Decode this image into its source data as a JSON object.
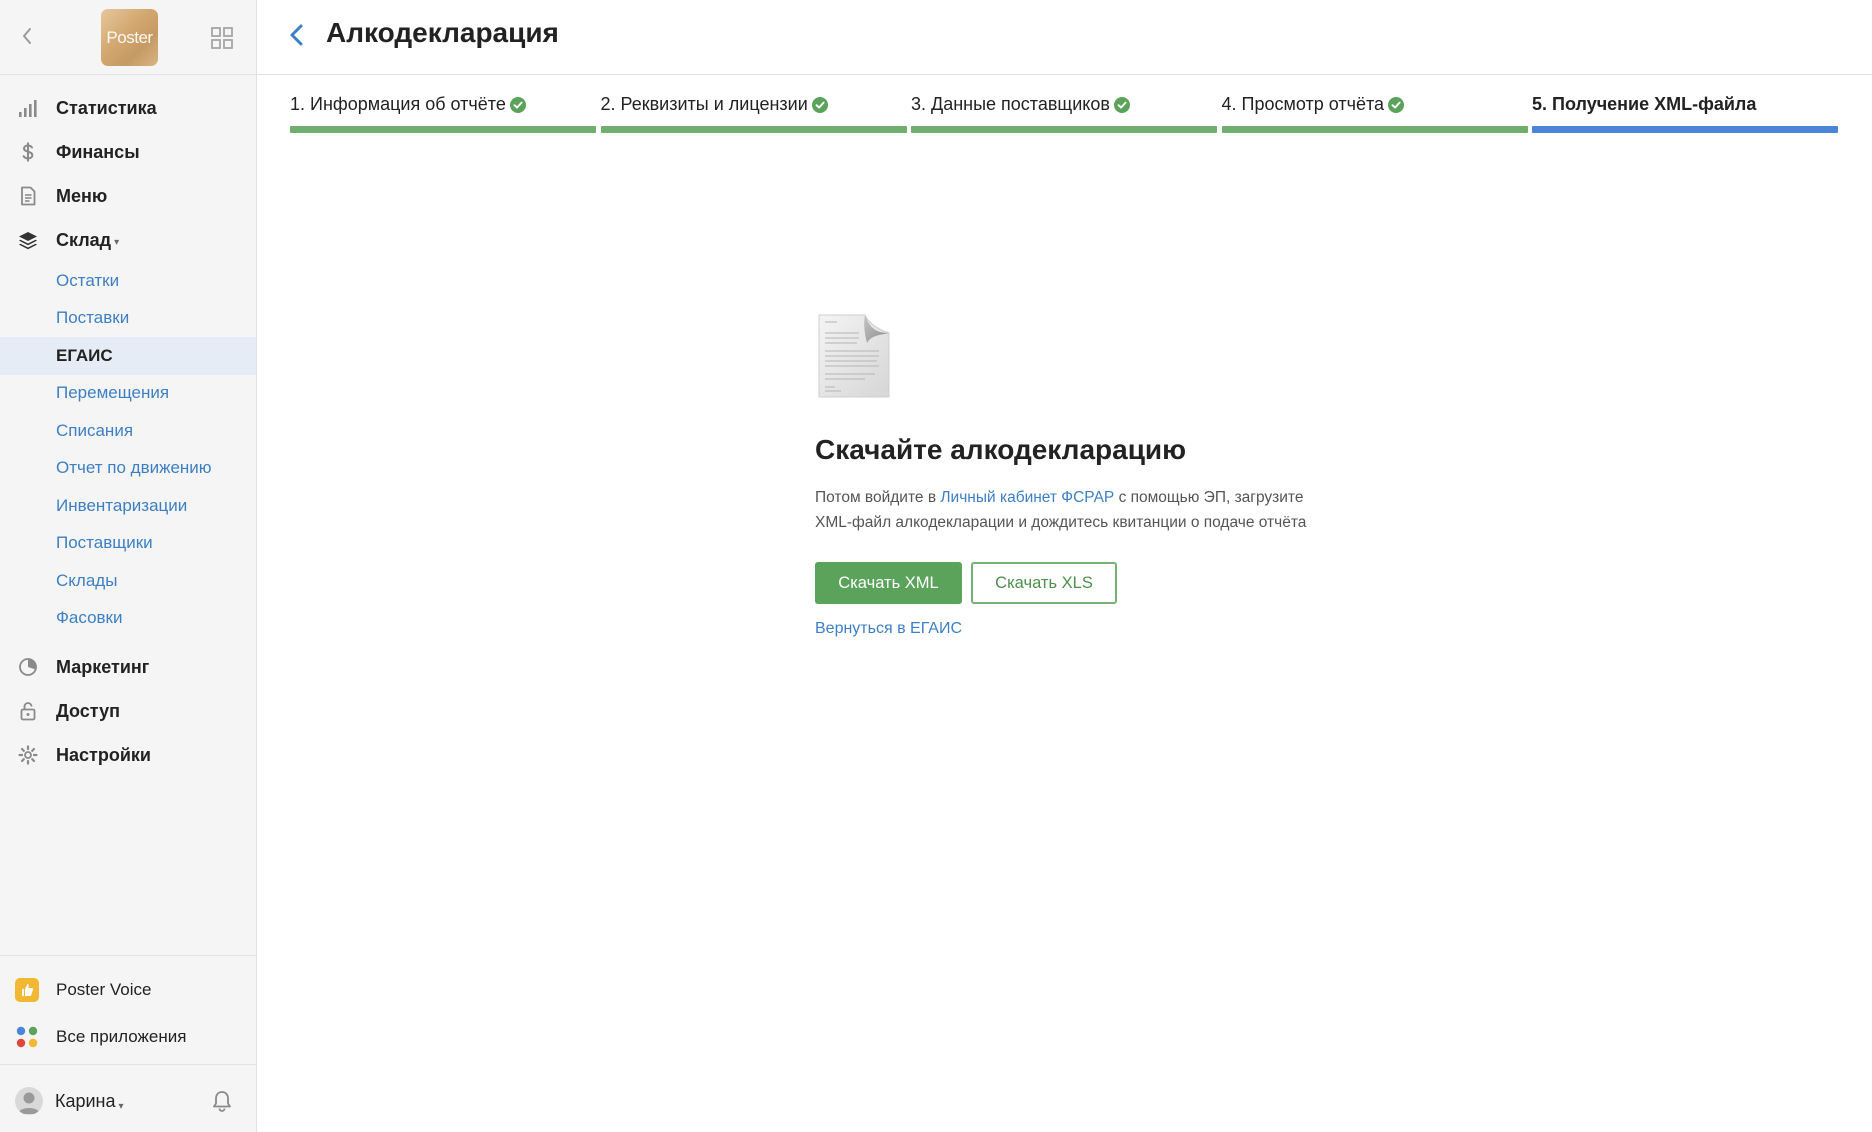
{
  "app": {
    "logo_text": "Poster"
  },
  "header": {
    "title": "Алкодекларация"
  },
  "sidebar": {
    "items": [
      {
        "label": "Статистика",
        "icon": "bar-chart-icon"
      },
      {
        "label": "Финансы",
        "icon": "dollar-icon"
      },
      {
        "label": "Меню",
        "icon": "document-icon"
      },
      {
        "label": "Склад",
        "icon": "layers-icon",
        "expanded": true
      }
    ],
    "warehouse_sub": [
      {
        "label": "Остатки"
      },
      {
        "label": "Поставки"
      },
      {
        "label": "ЕГАИС",
        "active": true
      },
      {
        "label": "Перемещения"
      },
      {
        "label": "Списания"
      },
      {
        "label": "Отчет по движению"
      },
      {
        "label": "Инвентаризации"
      },
      {
        "label": "Поставщики"
      },
      {
        "label": "Склады"
      },
      {
        "label": "Фасовки"
      }
    ],
    "items_after": [
      {
        "label": "Маркетинг",
        "icon": "marketing-icon"
      },
      {
        "label": "Доступ",
        "icon": "lock-icon"
      },
      {
        "label": "Настройки",
        "icon": "gear-icon"
      }
    ],
    "apps": [
      {
        "label": "Poster Voice",
        "icon": "thumbs-up-icon"
      },
      {
        "label": "Все приложения",
        "icon": "apps-dots-icon"
      }
    ],
    "user": {
      "name": "Карина"
    }
  },
  "steps": [
    {
      "label": "1. Информация об отчёте",
      "done": true
    },
    {
      "label": "2. Реквизиты и лицензии",
      "done": true
    },
    {
      "label": "3. Данные поставщиков",
      "done": true
    },
    {
      "label": "4. Просмотр отчёта",
      "done": true
    },
    {
      "label": "5. Получение XML-файла",
      "done": false,
      "current": true
    }
  ],
  "content": {
    "title": "Скачайте алкодекларацию",
    "text_before_link": "Потом войдите в ",
    "link_text": "Личный кабинет ФСРАР",
    "text_after_link": " с помощью ЭП, загрузите XML-файл алкодекларации и дождитесь квитанции о подаче отчёта",
    "download_xml": "Скачать XML",
    "download_xls": "Скачать XLS",
    "back_link": "Вернуться в ЕГАИС"
  },
  "colors": {
    "step_done": "#6fae6d",
    "step_current": "#4a86d8",
    "link": "#3d7fc4",
    "primary_button": "#5ba35a"
  }
}
